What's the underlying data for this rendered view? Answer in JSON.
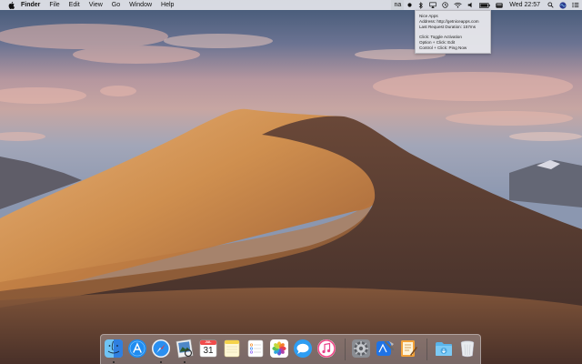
{
  "menubar": {
    "app_name": "Finder",
    "menus": [
      "File",
      "Edit",
      "View",
      "Go",
      "Window",
      "Help"
    ],
    "status_text": "na",
    "clock": "Wed 22:57"
  },
  "tooltip": {
    "lines": [
      "Nice Apps",
      "Address: http://getniceapps.com",
      "Last Request Duration: 157ms",
      "",
      "Click: Toggle Activation",
      "Option + Click: Edit",
      "Control + Click: Ping Now"
    ]
  },
  "dock": {
    "calendar_day": "31",
    "calendar_month": "JUL",
    "apps": [
      {
        "icon": "finder-icon",
        "running": true
      },
      {
        "icon": "app-store-icon",
        "running": false
      },
      {
        "icon": "safari-icon",
        "running": true
      },
      {
        "icon": "preview-icon",
        "running": true
      },
      {
        "icon": "calendar-icon",
        "running": false
      },
      {
        "icon": "notes-icon",
        "running": false
      },
      {
        "icon": "reminders-icon",
        "running": false
      },
      {
        "icon": "photos-icon",
        "running": false
      },
      {
        "icon": "messages-icon",
        "running": false
      },
      {
        "icon": "itunes-icon",
        "running": false
      },
      {
        "icon": "system-preferences-icon",
        "running": false
      },
      {
        "icon": "xcode-icon",
        "running": false
      },
      {
        "icon": "script-editor-icon",
        "running": false
      },
      {
        "icon": "downloads-folder-icon",
        "running": false
      },
      {
        "icon": "trash-icon",
        "running": false
      }
    ]
  },
  "colors": {
    "menubar_bg": "#ececf0",
    "accent": "#1f73e6",
    "sand_light": "#d9a062",
    "sand_dark": "#5a3d2e"
  }
}
